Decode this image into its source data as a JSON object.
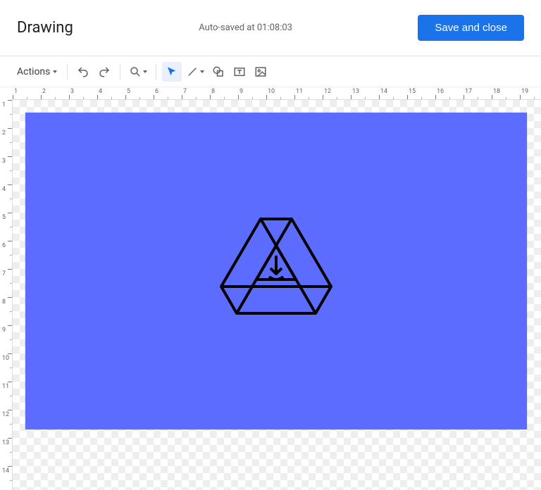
{
  "header": {
    "title": "Drawing",
    "autosave": "Auto-saved at 01:08:03",
    "save_button": "Save and close"
  },
  "toolbar": {
    "actions_label": "Actions",
    "tools": {
      "undo": "Undo",
      "redo": "Redo",
      "zoom": "Zoom",
      "select": "Select",
      "line": "Line",
      "shape": "Shape",
      "textbox": "Text box",
      "image": "Image"
    }
  },
  "canvas": {
    "background_color": "#5c6cff",
    "ruler_h_labels": [
      "1",
      "2",
      "3",
      "4",
      "5",
      "6",
      "7",
      "8",
      "9",
      "10",
      "11",
      "12",
      "13",
      "14",
      "15",
      "16",
      "17",
      "18",
      "19"
    ],
    "ruler_v_labels": [
      "1",
      "2",
      "3",
      "4",
      "5",
      "6",
      "7",
      "8",
      "9",
      "10",
      "11",
      "12",
      "13",
      "14"
    ],
    "shape": "drive-download-logo"
  }
}
